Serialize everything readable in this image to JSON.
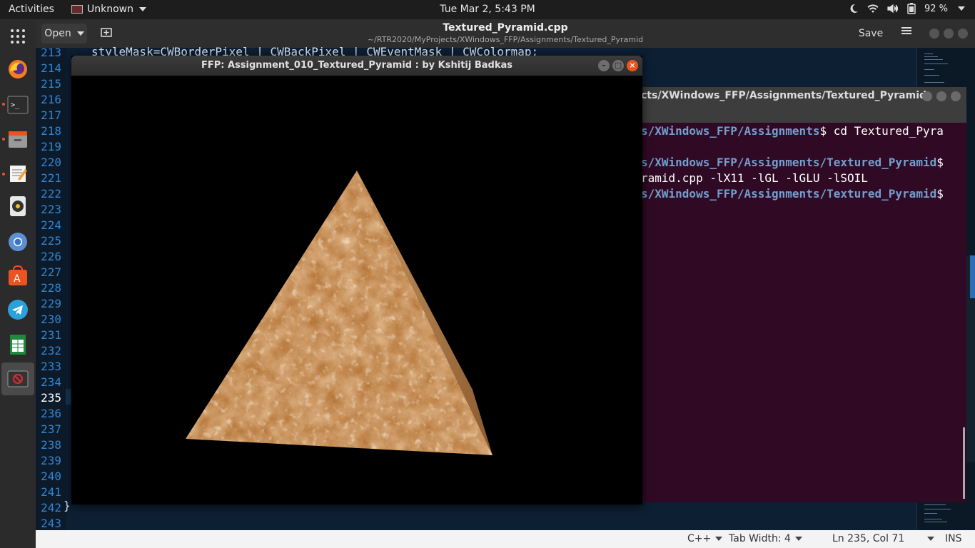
{
  "topbar": {
    "activities": "Activities",
    "app_name": "Unknown",
    "clock": "Tue Mar  2,  5:43 PM",
    "battery": "92 %"
  },
  "editor": {
    "open_label": "Open",
    "title": "Textured_Pyramid.cpp",
    "subtitle": "~/RTR2020/MyProjects/XWindows_FFP/Assignments/Textured_Pyramid",
    "save_label": "Save",
    "visible_code_top": "styleMask=CWBorderPixel | CWBackPixel | CWEventMask | CWColormap;",
    "closing_brace": "}",
    "line_numbers": [
      "213",
      "214",
      "215",
      "216",
      "217",
      "218",
      "219",
      "220",
      "221",
      "222",
      "223",
      "224",
      "225",
      "226",
      "227",
      "228",
      "229",
      "230",
      "231",
      "232",
      "233",
      "234",
      "235",
      "236",
      "237",
      "238",
      "239",
      "240",
      "241",
      "242",
      "243"
    ],
    "current_line": "235"
  },
  "statusbar": {
    "language": "C++",
    "tab_width": "Tab Width: 4",
    "position": "Ln 235, Col 71",
    "mode": "INS"
  },
  "terminal": {
    "title": "cts/XWindows_FFP/Assignments/Textured_Pyramid",
    "lines": [
      {
        "path": "s/XWindows_FFP/Assignments",
        "rest": "$ cd Textured_Pyra"
      },
      {
        "path": "",
        "rest": ""
      },
      {
        "path": "s/XWindows_FFP/Assignments/Textured_Pyramid",
        "rest": "$"
      },
      {
        "path": "",
        "rest": "ramid.cpp -lX11 -lGL -lGLU -lSOIL"
      },
      {
        "path": "s/XWindows_FFP/Assignments/Textured_Pyramid",
        "rest": "$"
      }
    ]
  },
  "glwindow": {
    "title": "FFP: Assignment_010_Textured_Pyramid : by Kshitij Badkas"
  },
  "colors": {
    "accent": "#e95420",
    "terminal_bg": "#300a24",
    "editor_bg": "#0d1f33",
    "line_number": "#2f86d0"
  },
  "dock": [
    "firefox-icon",
    "terminal-icon",
    "files-icon",
    "text-editor-icon",
    "rhythmbox-icon",
    "chromium-icon",
    "software-center-icon",
    "telegram-icon",
    "spreadsheet-icon",
    "recording-app-icon"
  ]
}
